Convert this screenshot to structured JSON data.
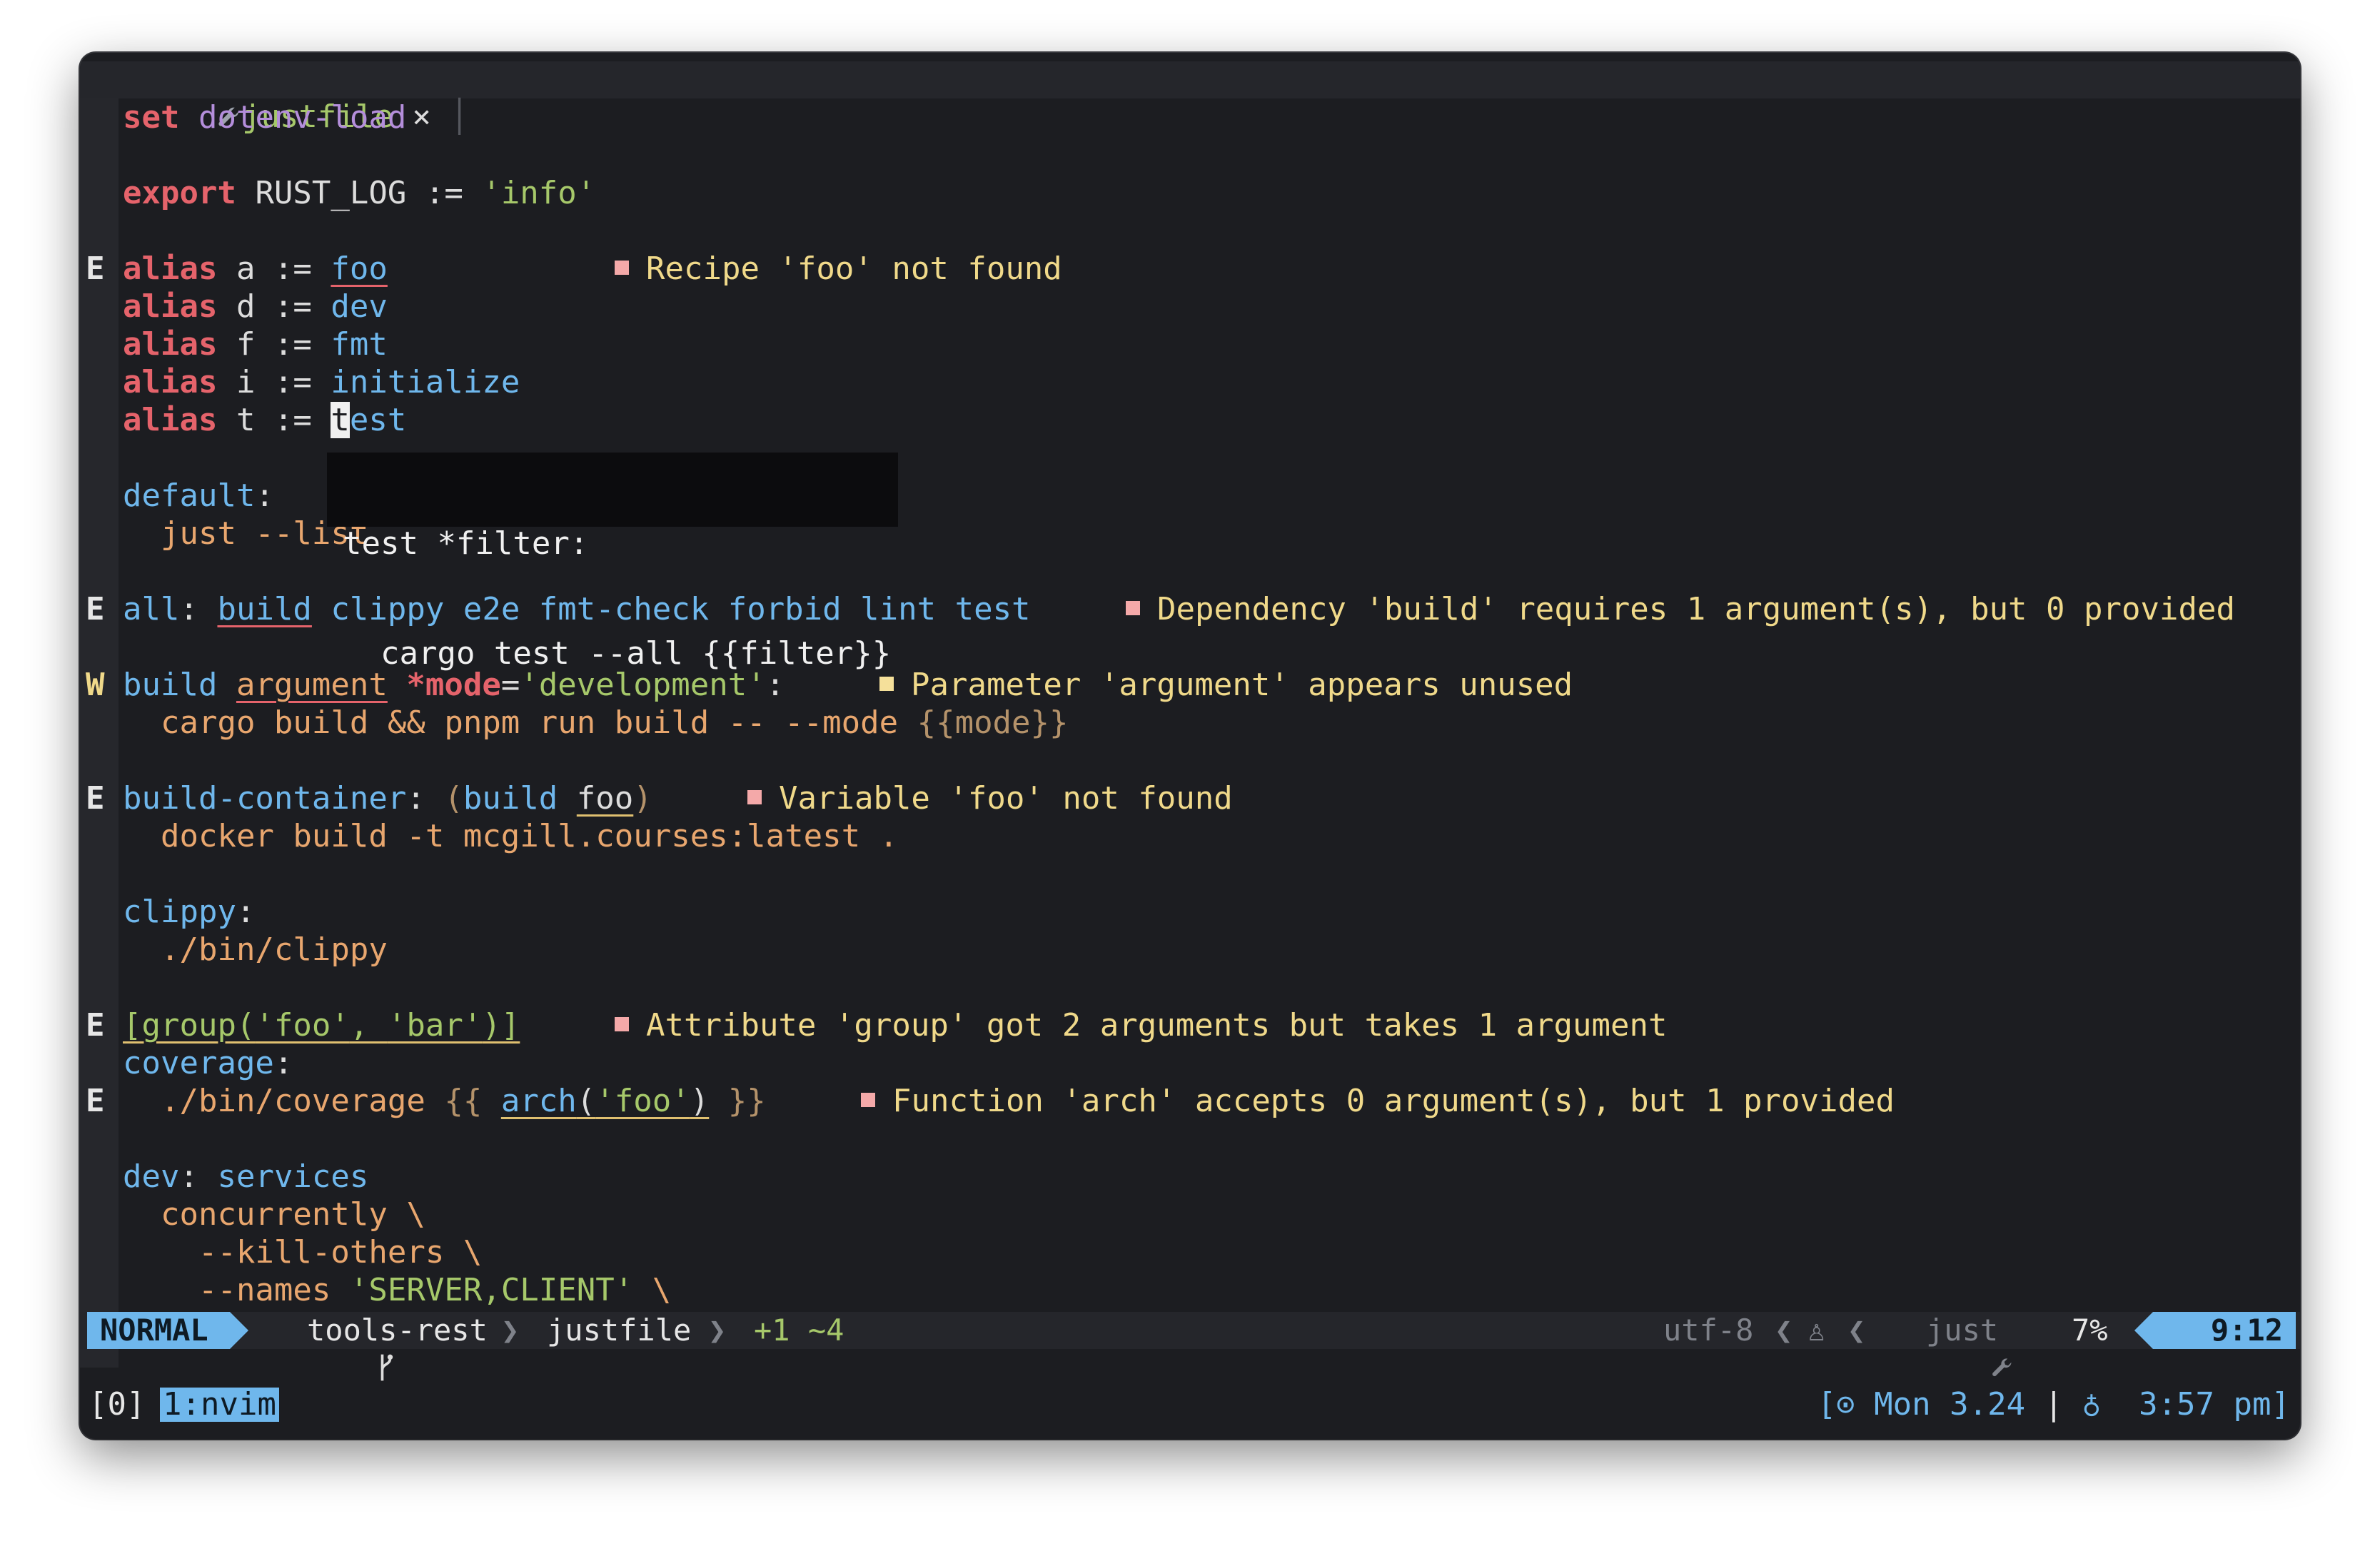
{
  "tabline": {
    "tab_icon": "wrench-icon",
    "tab_label": "justfile",
    "tab_close": "×"
  },
  "lines": [
    {
      "sign": "",
      "segs": [
        [
          "set ",
          "kw"
        ],
        [
          "dotenv-load",
          "kw2"
        ]
      ]
    },
    {
      "sign": "",
      "segs": []
    },
    {
      "sign": "",
      "segs": [
        [
          "export ",
          "kw"
        ],
        [
          "RUST_LOG := ",
          ""
        ],
        [
          "'info'",
          "str"
        ]
      ]
    },
    {
      "sign": "",
      "segs": []
    },
    {
      "sign": "E",
      "segs": [
        [
          "alias ",
          "kw"
        ],
        [
          "a := ",
          ""
        ],
        [
          "foo",
          "fn ul-red"
        ]
      ],
      "diag": {
        "kind": "err",
        "col": 26,
        "text": "Recipe 'foo' not found"
      }
    },
    {
      "sign": "",
      "segs": [
        [
          "alias ",
          "kw"
        ],
        [
          "d := ",
          ""
        ],
        [
          "dev",
          "fn"
        ]
      ]
    },
    {
      "sign": "",
      "segs": [
        [
          "alias ",
          "kw"
        ],
        [
          "f := ",
          ""
        ],
        [
          "fmt",
          "fn"
        ]
      ]
    },
    {
      "sign": "",
      "segs": [
        [
          "alias ",
          "kw"
        ],
        [
          "i := ",
          ""
        ],
        [
          "initialize",
          "fn"
        ]
      ]
    },
    {
      "sign": "",
      "segs": [
        [
          "alias ",
          "kw"
        ],
        [
          "t := ",
          ""
        ],
        [
          "t",
          "cursor"
        ],
        [
          "est",
          "fn"
        ]
      ]
    },
    {
      "sign": "",
      "segs": []
    },
    {
      "sign": "",
      "segs": [
        [
          "default",
          "fn"
        ],
        [
          ":",
          ""
        ]
      ]
    },
    {
      "sign": "",
      "segs": [
        [
          "  just --list",
          "body"
        ]
      ]
    },
    {
      "sign": "",
      "segs": []
    },
    {
      "sign": "E",
      "segs": [
        [
          "all",
          "fn"
        ],
        [
          ": ",
          ""
        ],
        [
          "build",
          "fn ul-red"
        ],
        [
          " clippy e2e fmt-check forbid lint test",
          "fn"
        ]
      ],
      "diag": {
        "kind": "err",
        "col": 53,
        "text": "Dependency 'build' requires 1 argument(s), but 0 provided"
      }
    },
    {
      "sign": "",
      "segs": []
    },
    {
      "sign": "W",
      "segs": [
        [
          "build ",
          "fn"
        ],
        [
          "argument",
          "body ul-red"
        ],
        [
          " *mode",
          "kw"
        ],
        [
          "=",
          ""
        ],
        [
          "'development'",
          "str"
        ],
        [
          ":",
          ""
        ]
      ],
      "diag": {
        "kind": "warn",
        "col": 40,
        "text": "Parameter 'argument' appears unused"
      }
    },
    {
      "sign": "",
      "segs": [
        [
          "  cargo build && pnpm run build -- --mode ",
          "body"
        ],
        [
          "{{mode}}",
          "interp"
        ]
      ]
    },
    {
      "sign": "",
      "segs": []
    },
    {
      "sign": "E",
      "segs": [
        [
          "build-container",
          "fn"
        ],
        [
          ": ",
          ""
        ],
        [
          "(",
          "interp"
        ],
        [
          "build ",
          "fn"
        ],
        [
          "foo",
          "ul-yel"
        ],
        [
          ")",
          "interp"
        ]
      ],
      "diag": {
        "kind": "err",
        "col": 33,
        "text": "Variable 'foo' not found"
      }
    },
    {
      "sign": "",
      "segs": [
        [
          "  docker build -t mcgill.courses:latest .",
          "body"
        ]
      ]
    },
    {
      "sign": "",
      "segs": []
    },
    {
      "sign": "",
      "segs": [
        [
          "clippy",
          "fn"
        ],
        [
          ":",
          ""
        ]
      ]
    },
    {
      "sign": "",
      "segs": [
        [
          "  ./bin/clippy",
          "body"
        ]
      ]
    },
    {
      "sign": "",
      "segs": []
    },
    {
      "sign": "E",
      "segs": [
        [
          "[group(",
          "str ul-yel"
        ],
        [
          "'foo'",
          "str ul-yel"
        ],
        [
          ", ",
          "str ul-yel"
        ],
        [
          "'bar'",
          "str ul-yel"
        ],
        [
          ")]",
          "str ul-yel"
        ]
      ],
      "diag": {
        "kind": "err",
        "col": 26,
        "text": "Attribute 'group' got 2 arguments but takes 1 argument"
      }
    },
    {
      "sign": "",
      "segs": [
        [
          "coverage",
          "fn"
        ],
        [
          ":",
          ""
        ]
      ]
    },
    {
      "sign": "E",
      "segs": [
        [
          "  ./bin/coverage ",
          "body"
        ],
        [
          "{{ ",
          "interp"
        ],
        [
          "arch",
          "fn ul-yel"
        ],
        [
          "(",
          "ul-yel"
        ],
        [
          "'foo'",
          "str ul-yel"
        ],
        [
          ")",
          "ul-yel"
        ],
        [
          " }}",
          "interp"
        ]
      ],
      "diag": {
        "kind": "err",
        "col": 39,
        "text": "Function 'arch' accepts 0 argument(s), but 1 provided"
      }
    },
    {
      "sign": "",
      "segs": []
    },
    {
      "sign": "",
      "segs": [
        [
          "dev",
          "fn"
        ],
        [
          ": ",
          ""
        ],
        [
          "services",
          "fn"
        ]
      ]
    },
    {
      "sign": "",
      "segs": [
        [
          "  concurrently \\",
          "body"
        ]
      ]
    },
    {
      "sign": "",
      "segs": [
        [
          "    --kill-others \\",
          "body"
        ]
      ]
    },
    {
      "sign": "",
      "segs": [
        [
          "    --names ",
          "body"
        ],
        [
          "'SERVER,CLIENT'",
          "str"
        ],
        [
          " \\",
          "body"
        ]
      ]
    }
  ],
  "hover": {
    "line1": "test *filter:",
    "line2": "  cargo test --all {{filter}}"
  },
  "statusline": {
    "mode": "NORMAL",
    "branch_icon": "git-branch-icon",
    "branch": "tools-rest",
    "file": "justfile",
    "diff": "+1 ~4",
    "encoding": "utf-8",
    "os_icon": "linux-icon",
    "filetype_icon": "wrench-icon",
    "filetype": "just",
    "percent": "7%",
    "position": "9:12"
  },
  "tmux": {
    "session": "[0]",
    "window": "1:nvim",
    "date": "[⊙ Mon 3.24",
    "separator": "|",
    "time_icon": "battery-icon",
    "time": "3:57 pm]"
  },
  "colors": {
    "accent": "#6fb7ec",
    "keyword": "#e5636b",
    "string": "#a6c86a",
    "body": "#e8a66e",
    "background": "#1c1d21"
  }
}
